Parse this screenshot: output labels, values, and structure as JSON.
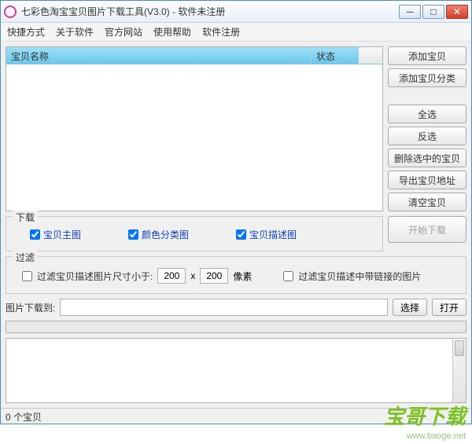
{
  "window": {
    "title": "七彩色淘宝宝贝图片下载工具(V3.0) - 软件未注册"
  },
  "menu": {
    "items": [
      "快捷方式",
      "关于软件",
      "官方网站",
      "使用帮助",
      "软件注册"
    ]
  },
  "list": {
    "col_name": "宝贝名称",
    "col_status": "状态"
  },
  "buttons": {
    "add_item": "添加宝贝",
    "add_category": "添加宝贝分类",
    "select_all": "全选",
    "invert": "反选",
    "delete_selected": "删除选中的宝贝",
    "export_url": "导出宝贝地址",
    "clear": "清空宝贝",
    "start_download": "开始下载"
  },
  "download": {
    "group_title": "下载",
    "main_image": "宝贝主图",
    "color_image": "颜色分类图",
    "desc_image": "宝贝描述图"
  },
  "filter": {
    "group_title": "过滤",
    "size_label": "过滤宝贝描述图片尺寸小于:",
    "width": "200",
    "times": "x",
    "height": "200",
    "px": "像素",
    "link_label": "过滤宝贝描述中带链接的图片"
  },
  "path": {
    "label": "图片下载到:",
    "value": "",
    "choose": "选择",
    "open": "打开"
  },
  "status": {
    "count": "0 个宝贝"
  },
  "watermark": {
    "text": "宝哥下载",
    "url": "www.baoge.net"
  }
}
